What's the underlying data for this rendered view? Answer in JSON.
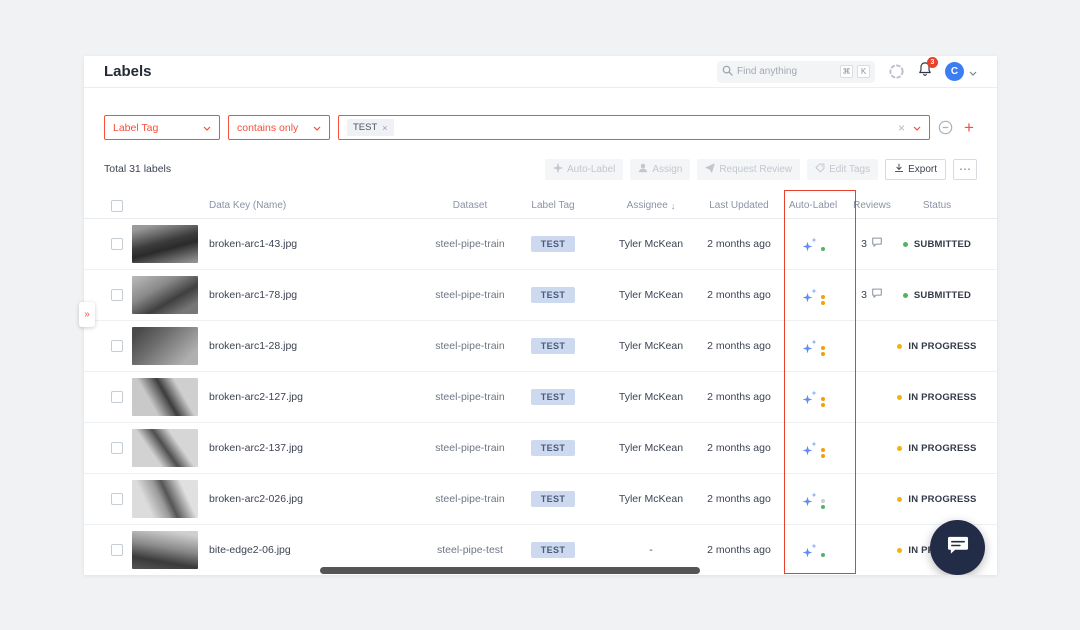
{
  "colors": {
    "accent": "#f4503a",
    "page-bg": "#f0f2f4",
    "panel-bg": "#ffffff",
    "tag-bg": "#cdd9ef",
    "tag-text": "#4a5a7a",
    "green": "#53b365",
    "yellow": "#f2b20c",
    "orange": "#f59e0b",
    "autolabel-blue": "#5f8bf7",
    "avatar-bg": "#3d7df2",
    "chat-bg": "#232c47",
    "annotation-red": "#e8402a"
  },
  "header": {
    "title": "Labels",
    "search_placeholder": "Find anything",
    "key_cmd": "⌘",
    "key_k": "K",
    "notification_count": "3",
    "avatar_initial": "C"
  },
  "filters": {
    "field": "Label Tag",
    "operator": "contains only",
    "chip": "TEST",
    "chip_remove": "×",
    "clear": "×",
    "plus": "+"
  },
  "toolbar": {
    "total": "Total 31 labels",
    "auto_label": "Auto-Label",
    "assign": "Assign",
    "request_review": "Request Review",
    "edit_tags": "Edit Tags",
    "export": "Export",
    "more": "⋯"
  },
  "expand_glyph": "»",
  "table": {
    "columns": [
      "Data Key (Name)",
      "Dataset",
      "Label Tag",
      "Assignee",
      "Last Updated",
      "Auto-Label",
      "Reviews",
      "Status"
    ],
    "sort_arrow": "↓",
    "rows": [
      {
        "name": "broken-arc1-43.jpg",
        "dataset": "steel-pipe-train",
        "tag": "TEST",
        "assignee": "Tyler McKean",
        "updated": "2 months ago",
        "reviews": "3",
        "status": "SUBMITTED"
      },
      {
        "name": "broken-arc1-78.jpg",
        "dataset": "steel-pipe-train",
        "tag": "TEST",
        "assignee": "Tyler McKean",
        "updated": "2 months ago",
        "reviews": "3",
        "status": "SUBMITTED"
      },
      {
        "name": "broken-arc1-28.jpg",
        "dataset": "steel-pipe-train",
        "tag": "TEST",
        "assignee": "Tyler McKean",
        "updated": "2 months ago",
        "reviews": "",
        "status": "IN PROGRESS"
      },
      {
        "name": "broken-arc2-127.jpg",
        "dataset": "steel-pipe-train",
        "tag": "TEST",
        "assignee": "Tyler McKean",
        "updated": "2 months ago",
        "reviews": "",
        "status": "IN PROGRESS"
      },
      {
        "name": "broken-arc2-137.jpg",
        "dataset": "steel-pipe-train",
        "tag": "TEST",
        "assignee": "Tyler McKean",
        "updated": "2 months ago",
        "reviews": "",
        "status": "IN PROGRESS"
      },
      {
        "name": "broken-arc2-026.jpg",
        "dataset": "steel-pipe-train",
        "tag": "TEST",
        "assignee": "Tyler McKean",
        "updated": "2 months ago",
        "reviews": "",
        "status": "IN PROGRESS"
      },
      {
        "name": "bite-edge2-06.jpg",
        "dataset": "steel-pipe-test",
        "tag": "TEST",
        "assignee": "-",
        "updated": "2 months ago",
        "reviews": "",
        "status": "IN PROGRESS"
      }
    ]
  }
}
